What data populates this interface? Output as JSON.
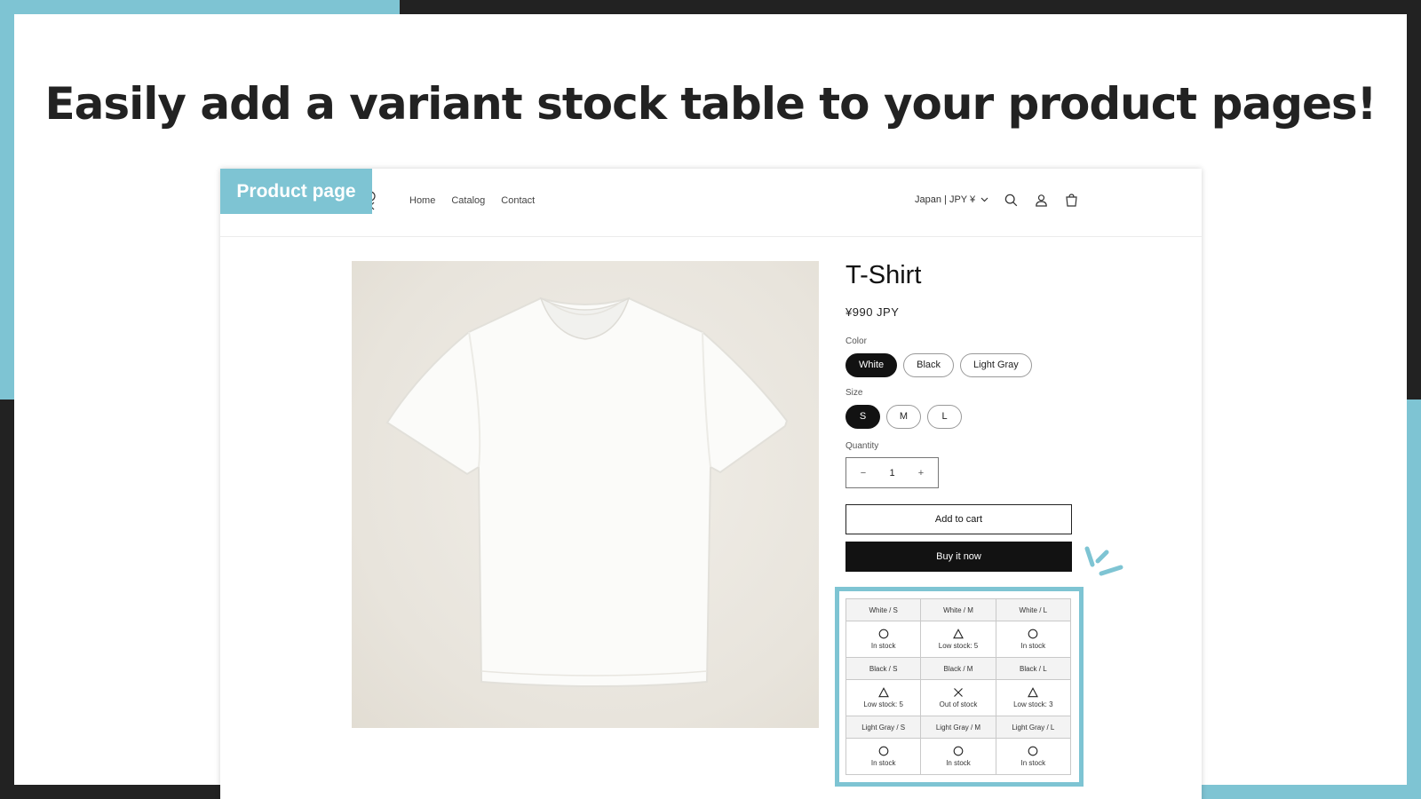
{
  "headline": "Easily add a variant stock table to your product pages!",
  "shop_label": "Product page",
  "nav": {
    "items": [
      "Home",
      "Catalog",
      "Contact"
    ]
  },
  "header": {
    "country": "Japan | JPY ¥"
  },
  "product": {
    "title": "T-Shirt",
    "price": "¥990 JPY",
    "color_label": "Color",
    "colors": [
      "White",
      "Black",
      "Light Gray"
    ],
    "selected_color": "White",
    "size_label": "Size",
    "sizes": [
      "S",
      "M",
      "L"
    ],
    "selected_size": "S",
    "quantity_label": "Quantity",
    "quantity": "1",
    "qty_minus": "−",
    "qty_plus": "+",
    "add_to_cart": "Add to cart",
    "buy_now": "Buy it now"
  },
  "stock_table": {
    "rows": [
      {
        "headers": [
          "White / S",
          "White / M",
          "White / L"
        ],
        "cells": [
          {
            "symbol": "circle",
            "text": "In stock"
          },
          {
            "symbol": "triangle",
            "text": "Low stock: 5"
          },
          {
            "symbol": "circle",
            "text": "In stock"
          }
        ]
      },
      {
        "headers": [
          "Black / S",
          "Black / M",
          "Black / L"
        ],
        "cells": [
          {
            "symbol": "triangle",
            "text": "Low stock: 5"
          },
          {
            "symbol": "cross",
            "text": "Out of stock"
          },
          {
            "symbol": "triangle",
            "text": "Low stock: 3"
          }
        ]
      },
      {
        "headers": [
          "Light Gray / S",
          "Light Gray / M",
          "Light Gray / L"
        ],
        "cells": [
          {
            "symbol": "circle",
            "text": "In stock"
          },
          {
            "symbol": "circle",
            "text": "In stock"
          },
          {
            "symbol": "circle",
            "text": "In stock"
          }
        ]
      }
    ]
  },
  "colors": {
    "accent": "#7ec4d3",
    "dark_bg": "#222222",
    "button_dark": "#121212"
  }
}
